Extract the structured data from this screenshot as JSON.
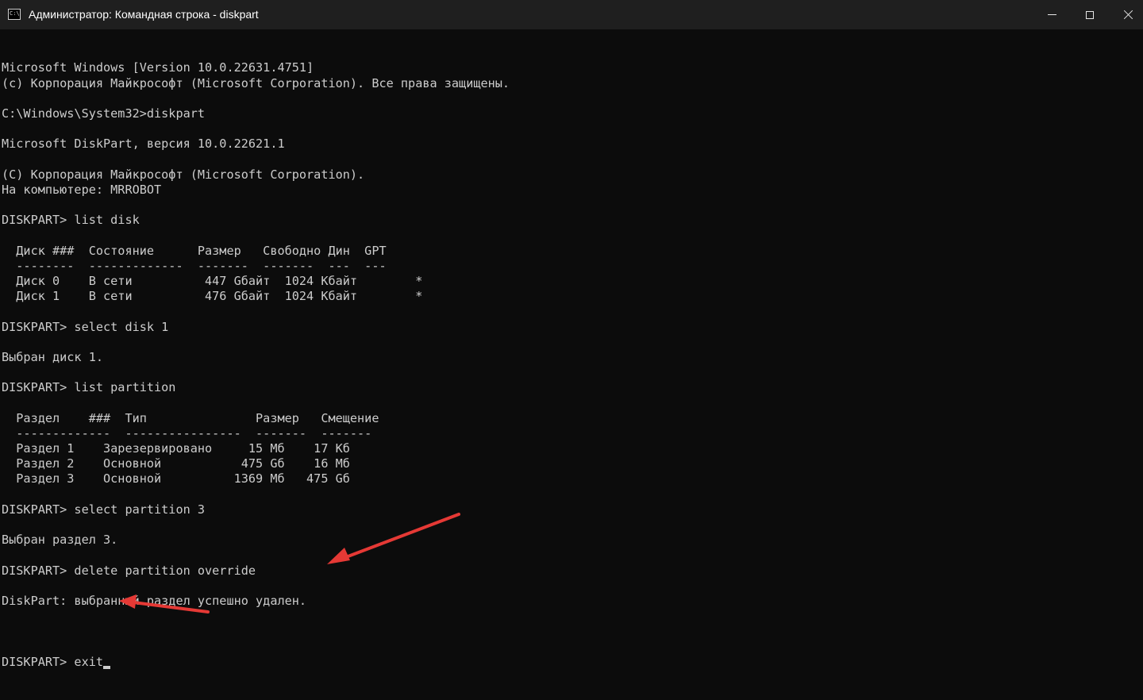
{
  "window": {
    "title": "Администратор: Командная строка - diskpart",
    "icon": "cmd-icon",
    "icon_glyph": "C:\\"
  },
  "controls": {
    "minimize_icon": "minimize-icon",
    "maximize_icon": "maximize-icon",
    "close_icon": "close-icon"
  },
  "console": {
    "lines": [
      "Microsoft Windows [Version 10.0.22631.4751]",
      "(c) Корпорация Майкрософт (Microsoft Corporation). Все права защищены.",
      "",
      "C:\\Windows\\System32>diskpart",
      "",
      "Microsoft DiskPart, версия 10.0.22621.1",
      "",
      "(C) Корпорация Майкрософт (Microsoft Corporation).",
      "На компьютере: MRROBOT",
      "",
      "DISKPART> list disk",
      "",
      "  Диск ###  Состояние      Размер   Свободно Дин  GPT",
      "  --------  -------------  -------  -------  ---  ---",
      "  Диск 0    В сети          447 Gбайт  1024 Кбайт        *",
      "  Диск 1    В сети          476 Gбайт  1024 Кбайт        *",
      "",
      "DISKPART> select disk 1",
      "",
      "Выбран диск 1.",
      "",
      "DISKPART> list partition",
      "",
      "  Раздел    ###  Тип               Размер   Смещение",
      "  -------------  ----------------  -------  -------",
      "  Раздел 1    Зарезервировано     15 Мб    17 Кб",
      "  Раздел 2    Основной           475 Gб    16 Мб",
      "  Раздел 3    Основной          1369 Мб   475 Gб",
      "",
      "DISKPART> select partition 3",
      "",
      "Выбран раздел 3.",
      "",
      "DISKPART> delete partition override",
      "",
      "DiskPart: выбранный раздел успешно удален.",
      ""
    ],
    "current_input": "DISKPART> exit"
  },
  "annotation_color": "#e53935"
}
